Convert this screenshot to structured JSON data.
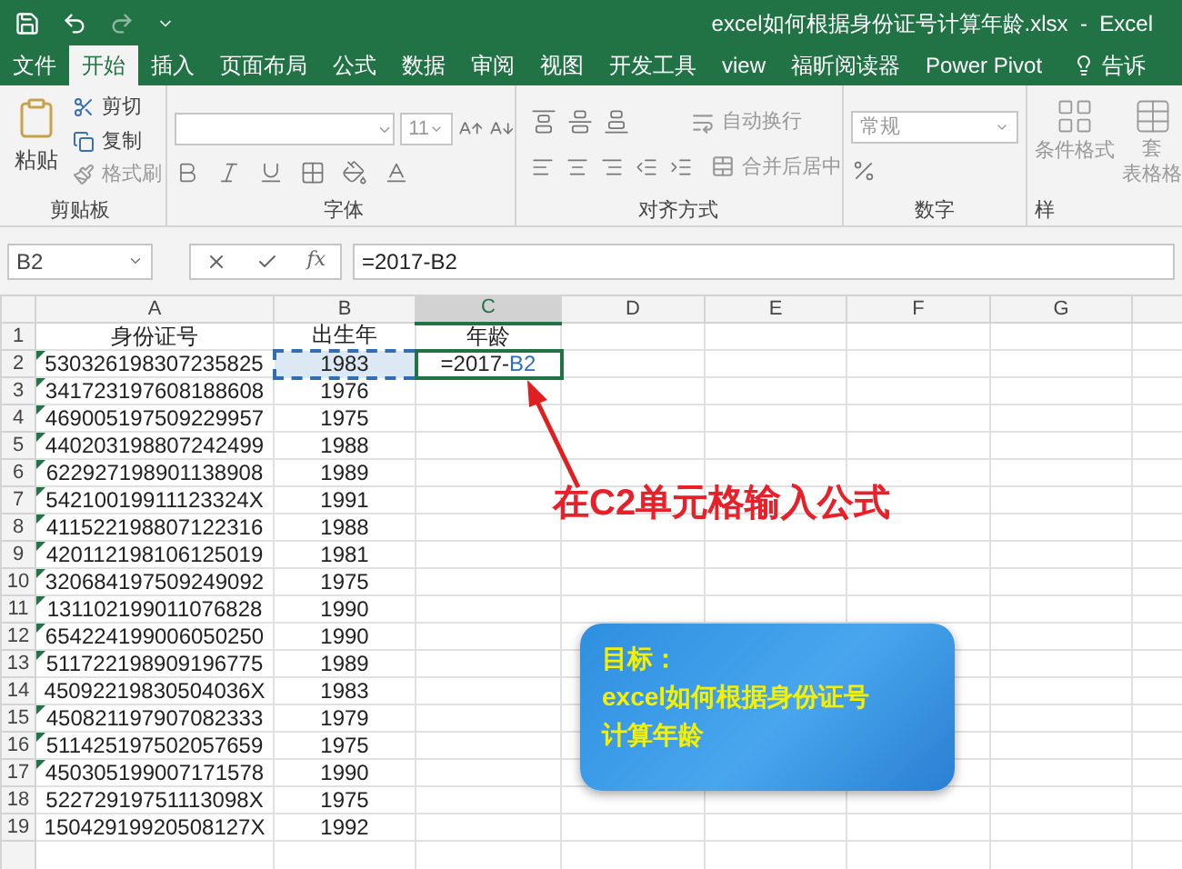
{
  "window": {
    "title": "excel如何根据身份证号计算年龄.xlsx  -  Excel"
  },
  "tabs": [
    {
      "label": "文件",
      "selected": false
    },
    {
      "label": "开始",
      "selected": true
    },
    {
      "label": "插入",
      "selected": false
    },
    {
      "label": "页面布局",
      "selected": false
    },
    {
      "label": "公式",
      "selected": false
    },
    {
      "label": "数据",
      "selected": false
    },
    {
      "label": "审阅",
      "selected": false
    },
    {
      "label": "视图",
      "selected": false
    },
    {
      "label": "开发工具",
      "selected": false
    },
    {
      "label": "view",
      "selected": false
    },
    {
      "label": "福昕阅读器",
      "selected": false
    },
    {
      "label": "Power Pivot",
      "selected": false
    }
  ],
  "tell_me": "告诉",
  "ribbon": {
    "clipboard": {
      "paste": "粘贴",
      "cut": "剪切",
      "copy": "复制",
      "format_painter": "格式刷",
      "label": "剪贴板"
    },
    "font": {
      "size": "11",
      "label": "字体"
    },
    "alignment": {
      "wrap": "自动换行",
      "merge": "合并后居中",
      "label": "对齐方式"
    },
    "number": {
      "format": "常规",
      "label": "数字"
    },
    "styles": {
      "conditional": "条件格式",
      "table_top": "套",
      "table_bottom": "表格格",
      "label": "样"
    }
  },
  "formula_bar": {
    "name_box": "B2",
    "function_label": "fx",
    "formula": "=2017-B2"
  },
  "sheet": {
    "columns": [
      {
        "label": "A",
        "selected": false
      },
      {
        "label": "B",
        "selected": false
      },
      {
        "label": "C",
        "selected": true
      },
      {
        "label": "D",
        "selected": false
      },
      {
        "label": "E",
        "selected": false
      },
      {
        "label": "F",
        "selected": false
      },
      {
        "label": "G",
        "selected": false
      }
    ],
    "header_row": {
      "number": "1",
      "id": "身份证号",
      "birth_year": "出生年",
      "age": "年龄"
    },
    "editing_cell": {
      "prefix": "=2017-",
      "reference": "B2"
    },
    "rows": [
      {
        "number": "2",
        "id": "530326198307235825",
        "birth_year": "1983",
        "flagged": true,
        "copied": true
      },
      {
        "number": "3",
        "id": "341723197608188608",
        "birth_year": "1976",
        "flagged": true,
        "copied": false
      },
      {
        "number": "4",
        "id": "469005197509229957",
        "birth_year": "1975",
        "flagged": true,
        "copied": false
      },
      {
        "number": "5",
        "id": "440203198807242499",
        "birth_year": "1988",
        "flagged": true,
        "copied": false
      },
      {
        "number": "6",
        "id": "622927198901138908",
        "birth_year": "1989",
        "flagged": true,
        "copied": false
      },
      {
        "number": "7",
        "id": "54210019911123324X",
        "birth_year": "1991",
        "flagged": true,
        "copied": false
      },
      {
        "number": "8",
        "id": "411522198807122316",
        "birth_year": "1988",
        "flagged": true,
        "copied": false
      },
      {
        "number": "9",
        "id": "420112198106125019",
        "birth_year": "1981",
        "flagged": true,
        "copied": false
      },
      {
        "number": "10",
        "id": "320684197509249092",
        "birth_year": "1975",
        "flagged": true,
        "copied": false
      },
      {
        "number": "11",
        "id": "131102199011076828",
        "birth_year": "1990",
        "flagged": true,
        "copied": false
      },
      {
        "number": "12",
        "id": "654224199006050250",
        "birth_year": "1990",
        "flagged": true,
        "copied": false
      },
      {
        "number": "13",
        "id": "511722198909196775",
        "birth_year": "1989",
        "flagged": true,
        "copied": false
      },
      {
        "number": "14",
        "id": "45092219830504036X",
        "birth_year": "1983",
        "flagged": false,
        "copied": false
      },
      {
        "number": "15",
        "id": "450821197907082333",
        "birth_year": "1979",
        "flagged": true,
        "copied": false
      },
      {
        "number": "16",
        "id": "511425197502057659",
        "birth_year": "1975",
        "flagged": true,
        "copied": false
      },
      {
        "number": "17",
        "id": "450305199007171578",
        "birth_year": "1990",
        "flagged": true,
        "copied": false
      },
      {
        "number": "18",
        "id": "52272919751113098X",
        "birth_year": "1975",
        "flagged": false,
        "copied": false
      },
      {
        "number": "19",
        "id": "15042919920508127X",
        "birth_year": "1992",
        "flagged": false,
        "copied": false
      }
    ]
  },
  "annotation": "在C2单元格输入公式",
  "callout": {
    "lines": [
      "目标：",
      "excel如何根据身份证号",
      "计算年龄"
    ]
  }
}
